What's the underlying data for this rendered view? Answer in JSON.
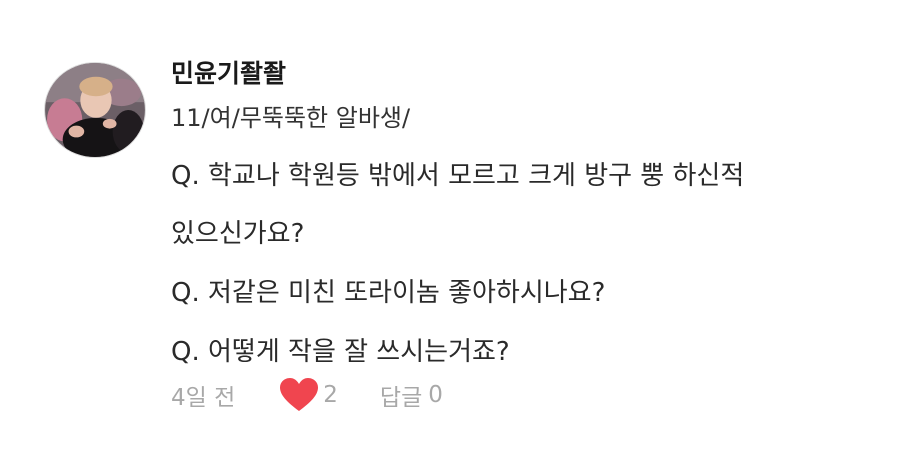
{
  "comment": {
    "username": "민윤기좔좔",
    "bio": "11/여/무뚝뚝한 알바생/",
    "lines": [
      "Q. 학교나 학원등 밖에서 모르고 크게 방구 뿡 하신적",
      "있으신가요?",
      "Q. 저같은 미친 또라이놈 좋아하시나요?",
      "Q. 어떻게 작을 잘 쓰시는거죠?"
    ],
    "time": "4일 전",
    "likes": "2",
    "reply_label": "답글",
    "reply_count": "0"
  },
  "colors": {
    "heart": "#f0454f",
    "meta_text": "#a8a8a8",
    "text": "#2a2a2a"
  },
  "icons": {
    "like": "heart-icon"
  }
}
